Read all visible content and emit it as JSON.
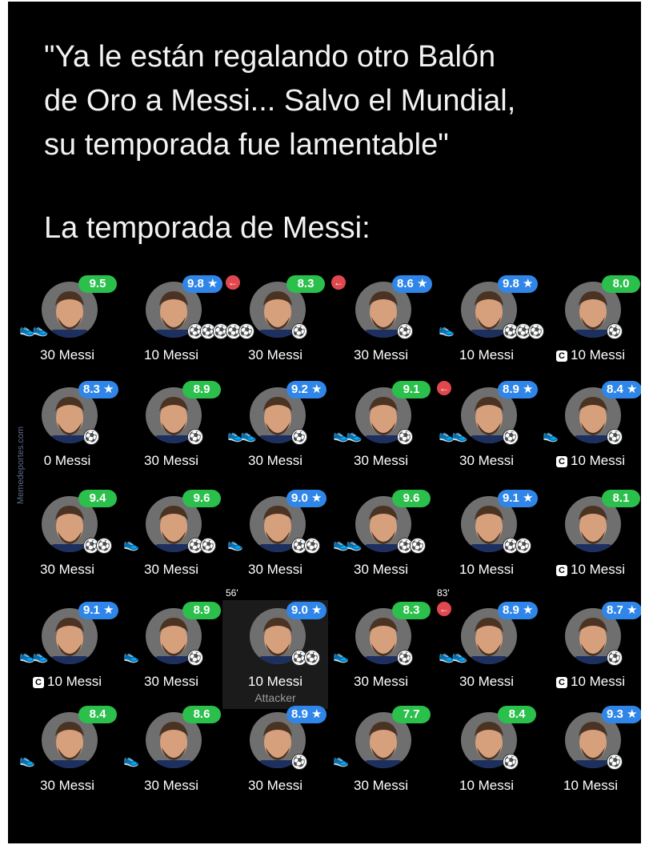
{
  "quote": "\"Ya le están regalando otro Balón\nde Oro a Messi... Salvo el Mundial,\nsu temporada fue lamentable\"",
  "subtitle": "La temporada de Messi:",
  "watermark": "Memedeportes.com",
  "colors": {
    "green": "#2bbf4b",
    "blue": "#2f86e8",
    "avatar": "#6f6f6f",
    "background": "#000000"
  },
  "rows": [
    {
      "cards": [
        {
          "rating": "9.5",
          "color": "green",
          "star": false,
          "label": "30 Messi",
          "goals": 0,
          "assists": 2,
          "captain": false,
          "sub": false
        },
        {
          "rating": "9.8 ★",
          "color": "blue",
          "star": true,
          "label": "10 Messi",
          "goals": 5,
          "assists": 0,
          "captain": false,
          "sub": false
        },
        {
          "rating": "8.3",
          "color": "green",
          "star": false,
          "label": "30 Messi",
          "goals": 1,
          "assists": 0,
          "captain": false,
          "sub": true
        },
        {
          "rating": "8.6 ★",
          "color": "blue",
          "star": true,
          "label": "30 Messi",
          "goals": 1,
          "assists": 0,
          "captain": false,
          "sub": true
        },
        {
          "rating": "9.8 ★",
          "color": "blue",
          "star": true,
          "label": "10 Messi",
          "goals": 3,
          "assists": 1,
          "captain": false,
          "sub": false
        },
        {
          "rating": "8.0",
          "color": "green",
          "star": false,
          "label": "10 Messi",
          "goals": 1,
          "assists": 0,
          "captain": true,
          "sub": false
        }
      ]
    },
    {
      "cards": [
        {
          "rating": "8.3 ★",
          "color": "blue",
          "star": true,
          "label": "0 Messi",
          "goals": 1,
          "assists": 0,
          "captain": false,
          "sub": false
        },
        {
          "rating": "8.9",
          "color": "green",
          "star": false,
          "label": "30 Messi",
          "goals": 1,
          "assists": 0,
          "captain": false,
          "sub": false
        },
        {
          "rating": "9.2 ★",
          "color": "blue",
          "star": true,
          "label": "30 Messi",
          "goals": 1,
          "assists": 2,
          "captain": false,
          "sub": false
        },
        {
          "rating": "9.1",
          "color": "green",
          "star": false,
          "label": "30 Messi",
          "goals": 1,
          "assists": 2,
          "captain": false,
          "sub": false
        },
        {
          "rating": "8.9 ★",
          "color": "blue",
          "star": true,
          "label": "30 Messi",
          "goals": 1,
          "assists": 2,
          "captain": false,
          "sub": true
        },
        {
          "rating": "8.4 ★",
          "color": "blue",
          "star": true,
          "label": "10 Messi",
          "goals": 1,
          "assists": 1,
          "captain": true,
          "sub": false
        }
      ]
    },
    {
      "cards": [
        {
          "rating": "9.4",
          "color": "green",
          "star": false,
          "label": "30 Messi",
          "goals": 2,
          "assists": 0,
          "captain": false,
          "sub": false
        },
        {
          "rating": "9.6",
          "color": "green",
          "star": false,
          "label": "30 Messi",
          "goals": 2,
          "assists": 1,
          "captain": false,
          "sub": false
        },
        {
          "rating": "9.0 ★",
          "color": "blue",
          "star": true,
          "label": "30 Messi",
          "goals": 2,
          "assists": 1,
          "captain": false,
          "sub": false
        },
        {
          "rating": "9.6",
          "color": "green",
          "star": false,
          "label": "30 Messi",
          "goals": 2,
          "assists": 2,
          "captain": false,
          "sub": false
        },
        {
          "rating": "9.1 ★",
          "color": "blue",
          "star": true,
          "label": "10 Messi",
          "goals": 2,
          "assists": 0,
          "captain": false,
          "sub": false
        },
        {
          "rating": "8.1",
          "color": "green",
          "star": false,
          "label": "10 Messi",
          "goals": 0,
          "assists": 0,
          "captain": true,
          "sub": false
        }
      ]
    },
    {
      "cards": [
        {
          "rating": "9.1 ★",
          "color": "blue",
          "star": true,
          "label": "10 Messi",
          "goals": 0,
          "assists": 2,
          "captain": true,
          "sub": false
        },
        {
          "rating": "8.9",
          "color": "green",
          "star": false,
          "label": "30 Messi",
          "goals": 1,
          "assists": 1,
          "captain": false,
          "sub": false
        },
        {
          "rating": "9.0 ★",
          "color": "blue",
          "star": true,
          "label": "10 Messi",
          "role": "Attacker",
          "minute": "56'",
          "goals": 2,
          "assists": 0,
          "captain": false,
          "sub": false,
          "highlight": true
        },
        {
          "rating": "8.3",
          "color": "green",
          "star": false,
          "label": "30 Messi",
          "goals": 1,
          "assists": 1,
          "captain": false,
          "sub": false
        },
        {
          "rating": "8.9 ★",
          "color": "blue",
          "star": true,
          "label": "30 Messi",
          "minute": "83'",
          "goals": 0,
          "assists": 2,
          "captain": false,
          "sub": true
        },
        {
          "rating": "8.7 ★",
          "color": "blue",
          "star": true,
          "label": "10 Messi",
          "goals": 1,
          "assists": 0,
          "captain": true,
          "sub": false
        }
      ]
    },
    {
      "cards": [
        {
          "rating": "8.4",
          "color": "green",
          "star": false,
          "label": "30 Messi",
          "goals": 0,
          "assists": 1,
          "captain": false,
          "sub": false
        },
        {
          "rating": "8.6",
          "color": "green",
          "star": false,
          "label": "30 Messi",
          "goals": 0,
          "assists": 1,
          "captain": false,
          "sub": false
        },
        {
          "rating": "8.9 ★",
          "color": "blue",
          "star": true,
          "label": "30 Messi",
          "goals": 1,
          "assists": 0,
          "captain": false,
          "sub": false
        },
        {
          "rating": "7.7",
          "color": "green",
          "star": false,
          "label": "30 Messi",
          "goals": 0,
          "assists": 1,
          "captain": false,
          "sub": false
        },
        {
          "rating": "8.4",
          "color": "green",
          "star": false,
          "label": "10 Messi",
          "goals": 1,
          "assists": 0,
          "captain": false,
          "sub": false
        },
        {
          "rating": "9.3 ★",
          "color": "blue",
          "star": true,
          "label": "10 Messi",
          "goals": 1,
          "assists": 0,
          "captain": false,
          "sub": false
        }
      ]
    }
  ]
}
